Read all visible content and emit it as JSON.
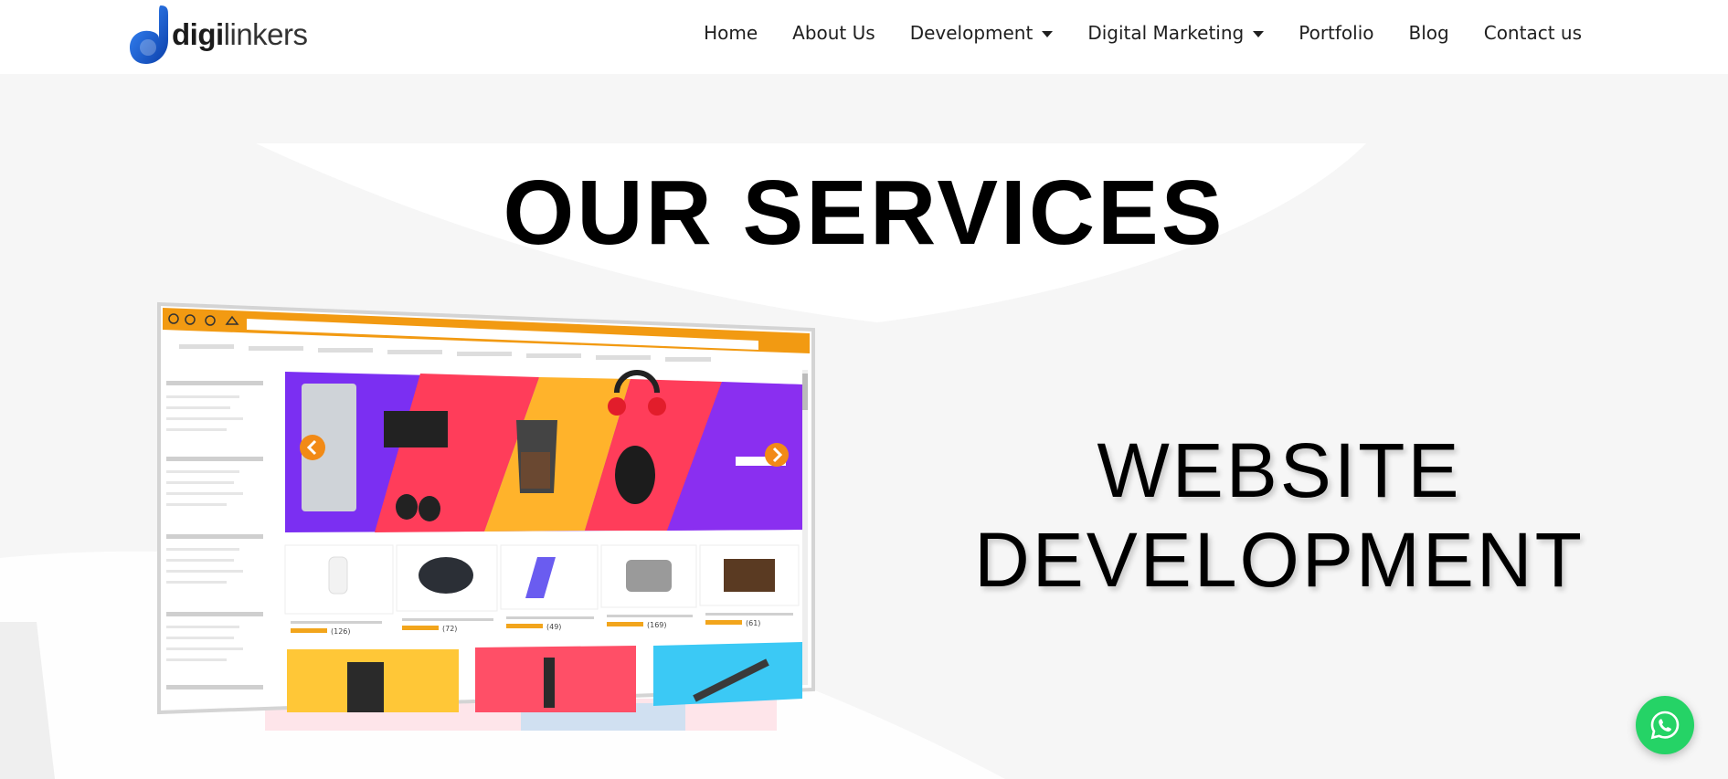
{
  "brand": {
    "logo_bold": "digi",
    "logo_light": "linkers",
    "accent": "#1565e0"
  },
  "nav": {
    "items": [
      {
        "label": "Home",
        "dropdown": false
      },
      {
        "label": "About Us",
        "dropdown": false
      },
      {
        "label": "Development",
        "dropdown": true
      },
      {
        "label": "Digital Marketing",
        "dropdown": true
      },
      {
        "label": "Portfolio",
        "dropdown": false
      },
      {
        "label": "Blog",
        "dropdown": false
      },
      {
        "label": "Contact us",
        "dropdown": false
      }
    ]
  },
  "hero": {
    "title": "OUR SERVICES",
    "service_line1": "WEBSITE",
    "service_line2": "DEVELOPMENT"
  },
  "mockup": {
    "ratings": [
      "(126)",
      "(72)",
      "(49)",
      "(169)",
      "(61)"
    ],
    "toolbar_color": "#f29a12"
  },
  "whatsapp": {
    "icon": "whatsapp-icon",
    "color": "#25d366"
  }
}
